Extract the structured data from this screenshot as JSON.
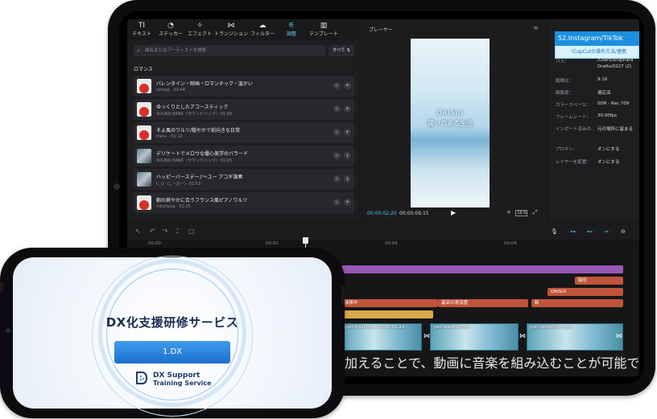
{
  "media": {
    "tabs": [
      {
        "icon": "TI",
        "label": "テキスト"
      },
      {
        "icon": "◔",
        "label": "ステッカー"
      },
      {
        "icon": "✧",
        "label": "エフェクト"
      },
      {
        "icon": "⋈",
        "label": "トランジション"
      },
      {
        "icon": "☁",
        "label": "フィルター"
      },
      {
        "icon": "⚟",
        "label": "調整"
      },
      {
        "icon": "▥",
        "label": "テンプレート"
      }
    ],
    "search_placeholder": "曲名またはアーティストを検索",
    "filter_label": "すべて",
    "category": "ロマンス",
    "tracks": [
      {
        "title": "バレンタイン・映画・ロマンチック・温かい",
        "meta": "zomap · 02:44"
      },
      {
        "title": "ゆっくりとしたアコースティック",
        "meta": "SOUND BANK（サウンドバンク）· 01:06"
      },
      {
        "title": "そよ風のワルツ/穏やかで前向きな日常",
        "meta": "mei+ · 01:12"
      },
      {
        "title": "デリケートでメロウな優心美学のバラード",
        "meta": "SOUND BANK（サウンドバンク）· 01:05"
      },
      {
        "title": "ハッピーバースデー♪～ユー アコギ演奏",
        "meta": "C_O（しーおー）· 01:53"
      },
      {
        "title": "朝の爽やかに合うフランス風ピアノワルツ",
        "meta": "mitchang · 01:15"
      }
    ]
  },
  "player": {
    "title": "プレーヤー",
    "video_title": "ORISUI",
    "video_subtitle": "潤いのある生活",
    "current_time": "00:00:02:20",
    "total_time": "00:00:09:15",
    "ratio_label": "16:9"
  },
  "properties": {
    "banner_title": "52.Instagram/TikTok",
    "banner_subtitle": "（CapCutの操作方法/連携",
    "rows": [
      {
        "key": "パス：",
        "value": "/Users/shigihara"
      },
      {
        "key": "",
        "value": "Drafts/0227 (2)"
      },
      {
        "key": "縦横比：",
        "value": "9:16"
      },
      {
        "key": "解像度：",
        "value": "適応済"
      },
      {
        "key": "カラースペース：",
        "value": "SDR - Rec.709"
      },
      {
        "key": "フレームレート：",
        "value": "30.00fps"
      },
      {
        "key": "インポート済みの…",
        "value": "元の場所に留まる"
      },
      {
        "key": "プロキシ：",
        "value": "オンにする"
      },
      {
        "key": "レイヤーを配置：",
        "value": "オンにする"
      }
    ]
  },
  "timeline": {
    "ruler": [
      "00:00",
      "00:02",
      "00:04",
      "00:06"
    ],
    "bars": [
      {
        "label": "",
        "color": "#9a57b6"
      },
      {
        "label": "脳化",
        "color": "#c0543a"
      },
      {
        "label": "ORISUI",
        "color": "#c0543a"
      },
      {
        "label": "液体中",
        "color": "#c0543a"
      },
      {
        "label": "最高の清涼感",
        "color": "#c0543a"
      },
      {
        "label": "新",
        "color": "#c0543a"
      },
      {
        "label": "",
        "color": "#d9a94a"
      }
    ],
    "clips": [
      "gen-josei.mp4  00:00:01:24",
      "gen-water2.mp4",
      "gen-petbottle.mp4"
    ],
    "caption": "加えることで、動画に音楽を組み込むことが可能です。"
  },
  "phone": {
    "title": "DX化支援研修サービス",
    "button_label": "1.DX",
    "logo_line1": "DX Support",
    "logo_line2": "Training Service"
  }
}
